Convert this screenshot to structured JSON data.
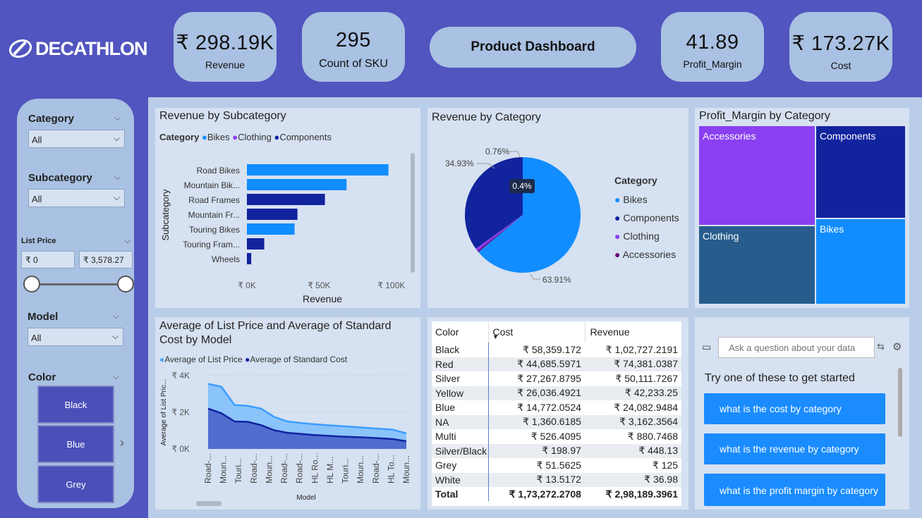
{
  "brand": "DECATHLON",
  "header": {
    "title": "Product Dashboard",
    "kpis": [
      {
        "value": "₹ 298.19K",
        "label": "Revenue"
      },
      {
        "value": "295",
        "label": "Count of SKU"
      },
      {
        "value": "41.89",
        "label": "Profit_Margin"
      },
      {
        "value": "₹ 173.27K",
        "label": "Cost"
      }
    ]
  },
  "filters": {
    "category": {
      "label": "Category",
      "value": "All"
    },
    "subcategory": {
      "label": "Subcategory",
      "value": "All"
    },
    "list_price": {
      "label": "List Price",
      "min": "₹ 0",
      "max": "₹ 3,578.27",
      "range_fraction": [
        0,
        1
      ]
    },
    "model": {
      "label": "Model",
      "value": "All"
    },
    "color": {
      "label": "Color",
      "options": [
        "Black",
        "Blue",
        "Grey"
      ]
    }
  },
  "colors": {
    "bikes": "#118dff",
    "components": "#12239e",
    "clothing": "#8a3ff0",
    "accessories": "#6b007b"
  },
  "chart_data": [
    {
      "type": "bar",
      "title": "Revenue by Subcategory",
      "legend_title": "Category",
      "legend": [
        "Bikes",
        "Clothing",
        "Components"
      ],
      "categories": [
        "Road Bikes",
        "Mountain Bik...",
        "Road Frames",
        "Mountain Fr...",
        "Touring Bikes",
        "Touring Fram...",
        "Wheels"
      ],
      "values": [
        98000,
        69000,
        54000,
        35000,
        33000,
        12000,
        3000
      ],
      "series_of": [
        "Bikes",
        "Bikes",
        "Components",
        "Components",
        "Bikes",
        "Components",
        "Components"
      ],
      "xlabel": "Revenue",
      "ylabel": "Subcategory",
      "xticks": [
        "₹ 0K",
        "₹ 50K",
        "₹ 100K"
      ],
      "xlim": [
        0,
        105000
      ]
    },
    {
      "type": "pie",
      "title": "Revenue by Category",
      "legend_title": "Category",
      "legend": [
        "Bikes",
        "Components",
        "Clothing",
        "Accessories"
      ],
      "values": [
        63.91,
        34.93,
        0.76,
        0.4
      ],
      "labels": [
        "63.91%",
        "34.93%",
        "0.76%",
        "0.4%"
      ]
    },
    {
      "type": "treemap",
      "title": "Profit_Margin by Category",
      "labels": [
        "Accessories",
        "Components",
        "Clothing",
        "Bikes"
      ]
    },
    {
      "type": "area",
      "title_line1": "Average of List Price and Average of Standard",
      "title_line2": "Cost by Model",
      "series": [
        {
          "name": "Average of List Price",
          "values": [
            3550,
            3400,
            2400,
            2350,
            2200,
            1750,
            1500,
            1420,
            1350,
            1300,
            1250,
            1200,
            1150,
            1100,
            1050,
            850
          ]
        },
        {
          "name": "Average of Standard Cost",
          "values": [
            2200,
            1950,
            1500,
            1480,
            1300,
            1020,
            880,
            820,
            760,
            720,
            680,
            650,
            620,
            580,
            540,
            420
          ]
        }
      ],
      "x": [
        "Road-...",
        "Moun...",
        "Touri...",
        "Road-...",
        "Moun...",
        "Road-...",
        "Road-...",
        "HL Ro...",
        "HL M...",
        "Touri...",
        "Moun...",
        "Road-...",
        "HL To...",
        "Moun..."
      ],
      "xlabel": "Model",
      "ylabel": "Average of List Pric...",
      "yticks": [
        "₹ 0K",
        "₹ 2K",
        "₹ 4K"
      ],
      "ylim": [
        0,
        4000
      ]
    },
    {
      "type": "table",
      "columns": [
        "Color",
        "Cost",
        "Revenue"
      ],
      "rows": [
        [
          "Black",
          "₹ 58,359.172",
          "₹ 1,02,727.2191"
        ],
        [
          "Red",
          "₹ 44,685.5971",
          "₹ 74,381.0387"
        ],
        [
          "Silver",
          "₹ 27,267.8795",
          "₹ 50,111.7267"
        ],
        [
          "Yellow",
          "₹ 26,036.4921",
          "₹ 42,233.25"
        ],
        [
          "Blue",
          "₹ 14,772.0524",
          "₹ 24,082.9484"
        ],
        [
          "NA",
          "₹ 1,360.6185",
          "₹ 3,162.3564"
        ],
        [
          "Multi",
          "₹ 526.4095",
          "₹ 880.7468"
        ],
        [
          "Silver/Black",
          "₹ 198.97",
          "₹ 448.13"
        ],
        [
          "Grey",
          "₹ 51.5625",
          "₹ 125"
        ],
        [
          "White",
          "₹ 13.5172",
          "₹ 36.98"
        ]
      ],
      "total": [
        "Total",
        "₹ 1,73,272.2708",
        "₹ 2,98,189.3961"
      ]
    }
  ],
  "qa": {
    "placeholder": "Ask a question about your data",
    "prompt": "Try one of these to get started",
    "suggestions": [
      "what is the cost by category",
      "what is the revenue by category",
      "what is the profit margin by category"
    ]
  }
}
